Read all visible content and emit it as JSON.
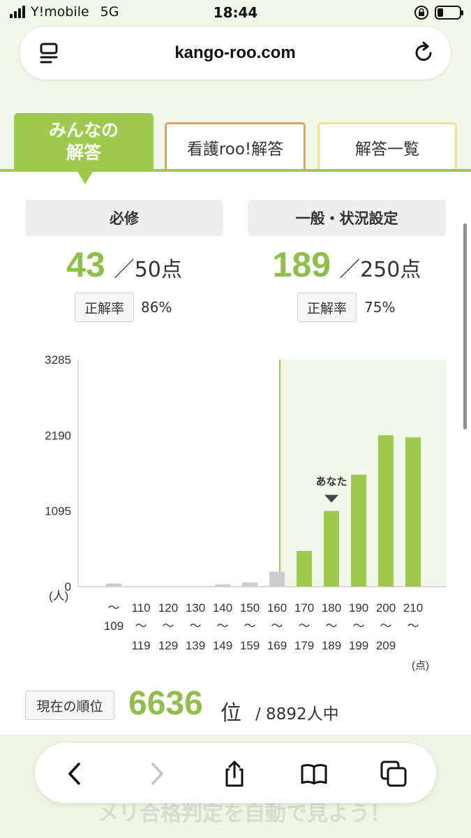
{
  "status": {
    "carrier": "Y!mobile",
    "network": "5G",
    "time": "18:44",
    "battery_level": 0.25
  },
  "browser": {
    "url": "kango-roo.com",
    "menu_icon": "page-menu-icon",
    "reload_icon": "reload-icon"
  },
  "tabs": [
    {
      "label": "みんなの\n解答",
      "active": true
    },
    {
      "label": "看護roo!解答",
      "active": false
    },
    {
      "label": "解答一覧",
      "active": false
    }
  ],
  "scores": {
    "hisshu": {
      "title": "必修",
      "score": "43",
      "total": "／50点",
      "rate_label": "正解率",
      "rate": "86%"
    },
    "ippan": {
      "title": "一般・状況設定",
      "score": "189",
      "total": "／250点",
      "rate_label": "正解率",
      "rate": "75%"
    }
  },
  "chart_data": {
    "type": "bar",
    "categories": [
      "〜109",
      "110〜119",
      "120〜129",
      "130〜139",
      "140〜149",
      "150〜159",
      "160〜169",
      "170〜179",
      "180〜189",
      "190〜199",
      "200〜209",
      "210〜"
    ],
    "cat_top": [
      "〜",
      "110",
      "120",
      "130",
      "140",
      "150",
      "160",
      "170",
      "180",
      "190",
      "200",
      "210"
    ],
    "cat_mid": [
      "109",
      "〜",
      "〜",
      "〜",
      "〜",
      "〜",
      "〜",
      "〜",
      "〜",
      "〜",
      "〜",
      "〜"
    ],
    "cat_bot": [
      "",
      "119",
      "129",
      "139",
      "149",
      "159",
      "169",
      "179",
      "189",
      "199",
      "209",
      ""
    ],
    "values": [
      45,
      0,
      0,
      0,
      18,
      60,
      215,
      515,
      1095,
      1620,
      2190,
      2160
    ],
    "highlight_from_index": 7,
    "you_index": 8,
    "you_label": "あなた",
    "yticks": [
      "3285",
      "2190",
      "1095",
      "0"
    ],
    "ytick_values": [
      3285,
      2190,
      1095,
      0
    ],
    "ylabel": "(人)",
    "xunit": "(点)",
    "ylim": [
      0,
      3285
    ],
    "colors": {
      "normal": "#cccccc",
      "highlight": "#9ec94f",
      "highlight_bg": "#f1f8e9"
    }
  },
  "rank": {
    "label": "現在の順位",
    "value": "6636",
    "unit": "位",
    "total": "/ 8892人中"
  },
  "toolbar": {
    "back_icon": "back-icon",
    "forward_icon": "forward-icon",
    "share_icon": "share-icon",
    "bookmarks_icon": "bookmarks-icon",
    "tabs_icon": "tabs-icon",
    "ghost_text": "メリ合格判定を自動で見よう！"
  }
}
